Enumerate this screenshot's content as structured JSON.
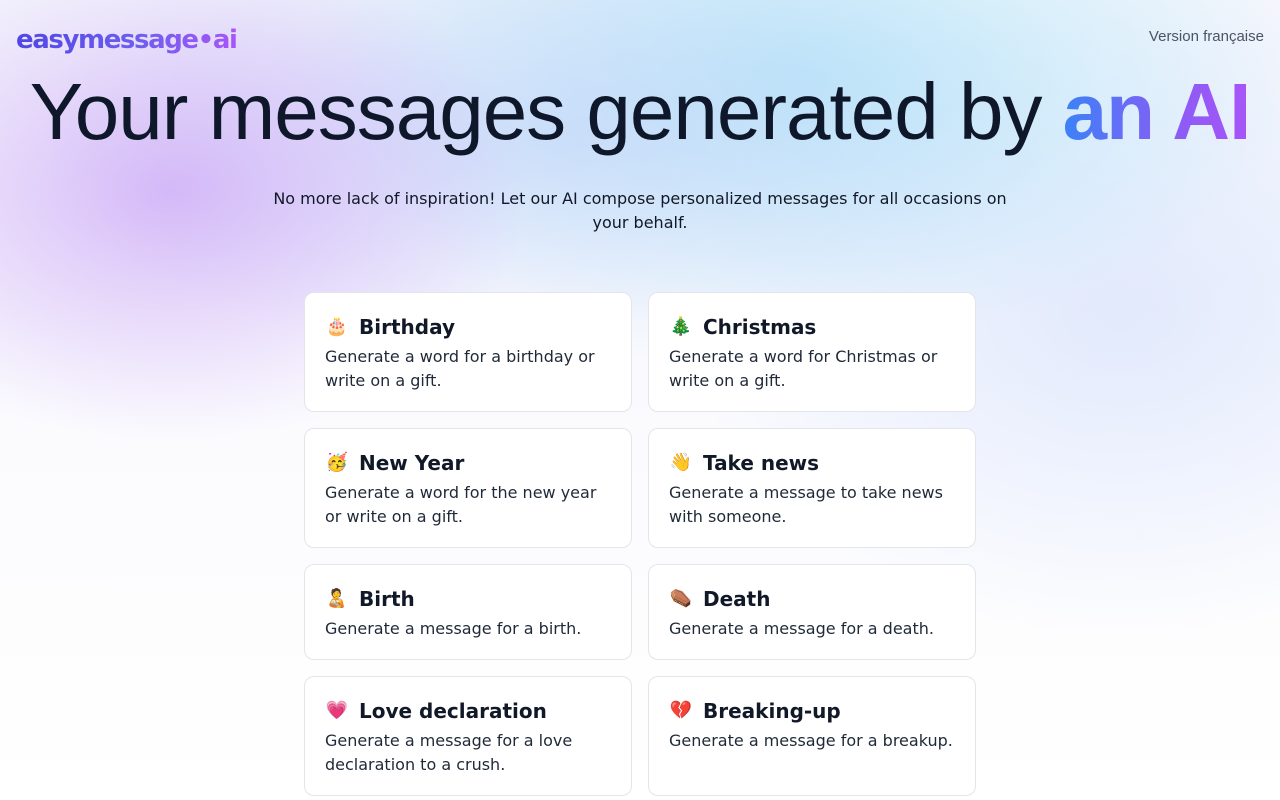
{
  "header": {
    "logo": "easymessage•ai",
    "lang_link": "Version française"
  },
  "hero": {
    "title_main": "Your messages generated by ",
    "title_accent": "an AI",
    "subtitle": "No more lack of inspiration! Let our AI compose personalized messages for all occasions on your behalf."
  },
  "cards": [
    {
      "icon": "birthday-cake-icon",
      "emoji": "🎂",
      "title": "Birthday",
      "description": "Generate a word for a birthday or write on a gift."
    },
    {
      "icon": "christmas-tree-icon",
      "emoji": "🎄",
      "title": "Christmas",
      "description": "Generate a word for Christmas or write on a gift."
    },
    {
      "icon": "party-face-icon",
      "emoji": "🥳",
      "title": "New Year",
      "description": "Generate a word for the new year or write on a gift."
    },
    {
      "icon": "waving-hand-icon",
      "emoji": "👋",
      "title": "Take news",
      "description": "Generate a message to take news with someone."
    },
    {
      "icon": "person-with-baby-icon",
      "emoji": "🧑‍🍼",
      "title": "Birth",
      "description": "Generate a message for a birth."
    },
    {
      "icon": "coffin-icon",
      "emoji": "⚰️",
      "title": "Death",
      "description": "Generate a message for a death."
    },
    {
      "icon": "heart-icon",
      "emoji": "💗",
      "title": "Love declaration",
      "description": "Generate a message for a love declaration to a crush."
    },
    {
      "icon": "broken-heart-icon",
      "emoji": "💔",
      "title": "Breaking-up",
      "description": "Generate a message for a breakup."
    }
  ],
  "colors": {
    "logo_gradient_start": "#4f46e5",
    "logo_gradient_end": "#a855f7",
    "accent_gradient_start": "#3b82f6",
    "accent_gradient_end": "#a855f7",
    "card_background": "#ffffff",
    "card_border": "#e3e5ea",
    "text": "#111827"
  }
}
